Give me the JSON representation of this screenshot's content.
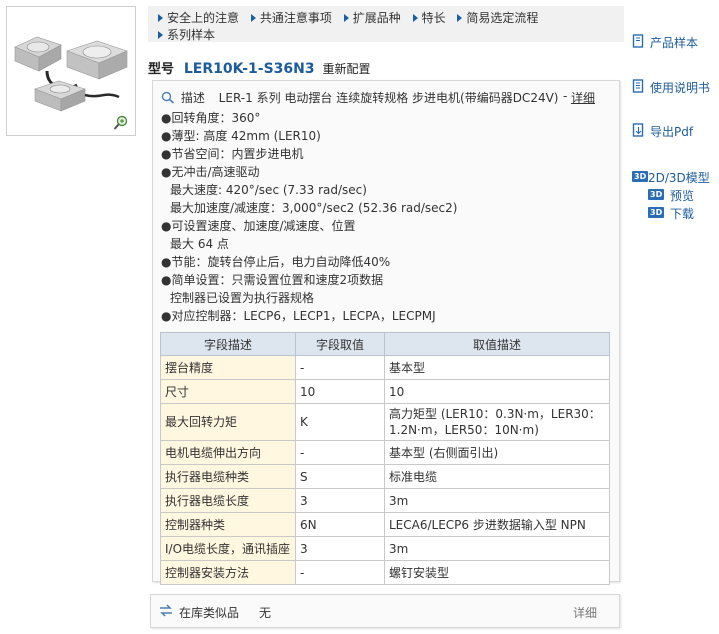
{
  "nav": {
    "row1": [
      "安全上的注意",
      "共通注意事项",
      "扩展品种",
      "特长",
      "简易选定流程"
    ],
    "row2": [
      "系列样本"
    ]
  },
  "model": {
    "label": "型号",
    "code": "LER10K-1-S36N3",
    "reconfigure": "重新配置"
  },
  "description": {
    "label": "描述",
    "text": "LER-1 系列 电动摆台 连续旋转规格 步进电机(带编码器DC24V)",
    "sep": "-",
    "detail": "详细",
    "features": [
      "●回转角度：360°",
      "●薄型: 高度 42mm (LER10)",
      "●节省空间：内置步进电机",
      "●无冲击/高速驱动",
      "最大速度: 420°/sec (7.33 rad/sec)",
      "最大加速度/减速度：3,000°/sec2 (52.36 rad/sec2)",
      "●可设置速度、加速度/减速度、位置",
      "最大 64 点",
      "●节能：旋转台停止后，电力自动降低40%",
      "●简单设置：只需设置位置和速度2项数据",
      "控制器已设置为执行器规格",
      "●对应控制器：LECP6，LECP1，LECPA，LECPMJ"
    ]
  },
  "table": {
    "headers": [
      "字段描述",
      "字段取值",
      "取值描述"
    ],
    "rows": [
      [
        "摆台精度",
        "-",
        "基本型"
      ],
      [
        "尺寸",
        "10",
        "10"
      ],
      [
        "最大回转力矩",
        "K",
        "高力矩型 (LER10：0.3N·m，LER30：1.2N·m，LER50：10N·m)"
      ],
      [
        "电机电缆伸出方向",
        "-",
        "基本型 (右侧面引出)"
      ],
      [
        "执行器电缆种类",
        "S",
        "标准电缆"
      ],
      [
        "执行器电缆长度",
        "3",
        "3m"
      ],
      [
        "控制器种类",
        "6N",
        "LECA6/LECP6 步进数据输入型 NPN"
      ],
      [
        "I/O电缆长度，通讯插座",
        "3",
        "3m"
      ],
      [
        "控制器安装方法",
        "-",
        "螺钉安装型"
      ]
    ]
  },
  "stock": {
    "label": "在库类似品",
    "value": "无",
    "detail": "详细"
  },
  "sidebar": {
    "catalog": "产品样本",
    "manual": "使用说明书",
    "pdf": "导出Pdf",
    "model3d": "2D/3D模型",
    "preview": "预览",
    "download": "下载",
    "tag3d": "3D"
  }
}
